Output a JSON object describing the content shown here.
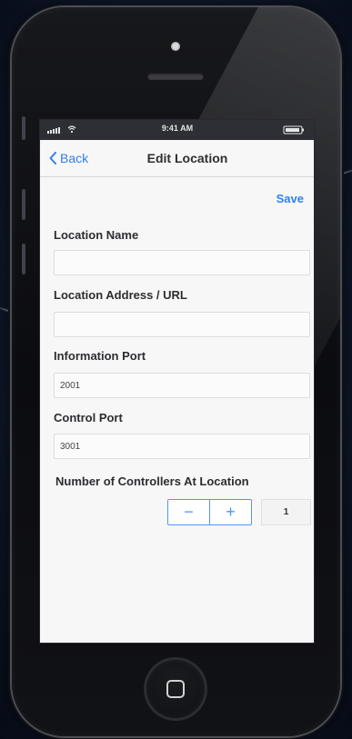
{
  "status_bar": {
    "time": "9:41 AM"
  },
  "nav": {
    "back_label": "Back",
    "title": "Edit Location"
  },
  "toolbar": {
    "save_label": "Save"
  },
  "form": {
    "location_name": {
      "label": "Location Name",
      "value": ""
    },
    "location_address": {
      "label": "Location Address / URL",
      "value": ""
    },
    "information_port": {
      "label": "Information Port",
      "value": "2001"
    },
    "control_port": {
      "label": "Control Port",
      "value": "3001"
    },
    "controllers": {
      "label": "Number of Controllers At Location",
      "minus": "−",
      "plus": "+",
      "value": "1"
    }
  },
  "colors": {
    "accent": "#2f7ff0",
    "status_bar": "#2d2f34",
    "screen_bg": "#f7f7f7"
  },
  "icons": {
    "signal": "signal-icon",
    "wifi": "wifi-icon",
    "battery": "battery-icon",
    "back": "chevron-left-icon",
    "home": "home-button-icon"
  }
}
